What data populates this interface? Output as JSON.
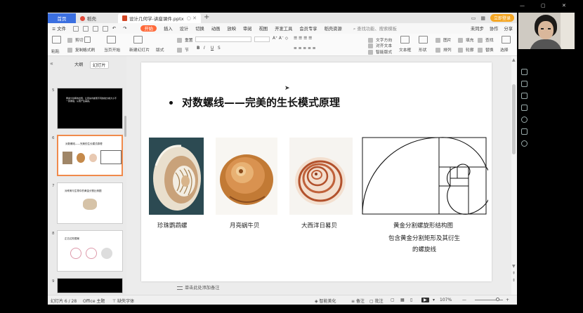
{
  "window_controls": [
    "—",
    "▢",
    "✕"
  ],
  "tabs": {
    "home": "首页",
    "draft": "稻壳",
    "file": "设计几何学-讲座课件.pptx"
  },
  "topbar_right": {
    "login": "立即登录"
  },
  "menu": {
    "file": "文件",
    "items": [
      "开始",
      "插入",
      "设计",
      "切换",
      "动画",
      "放映",
      "审阅",
      "视图",
      "开发工具",
      "会员专享",
      "稻壳资源"
    ],
    "active_index": 0,
    "search": "查找功能、搜索模板",
    "right": [
      "未同步",
      "协作",
      "分享"
    ]
  },
  "ribbon": {
    "paste": "粘贴",
    "cut": "剪切",
    "copy": "复制",
    "format_painter": "格式刷",
    "from_current": "当页开始",
    "new_slide": "新建幻灯片",
    "layout": "版式",
    "section": "节",
    "reset": "重置",
    "convert_smartart": "转换成图示",
    "text_box": "文本框",
    "shape": "形状",
    "picture": "图片",
    "arrange": "排列",
    "find": "查找",
    "replace": "替换",
    "select": "选择",
    "fill": "填充",
    "outline": "轮廓",
    "text_direction": "文字方向",
    "align_text": "对齐文本",
    "smart_layout": "智能版式"
  },
  "left_panel": {
    "tab_outline": "大纲",
    "tab_slides": "幻灯片",
    "slides": [
      {
        "num": "5",
        "text": "黄金分割率的出现，让原先均衡而不同的线分成大小不一的重组，从而产生美感。"
      },
      {
        "num": "6",
        "text": "对数螺线——完美的生长模式原理"
      },
      {
        "num": "7",
        "text": "对称美与生物中的黄金分割比例图"
      },
      {
        "num": "8",
        "text": "正五边形图案"
      },
      {
        "num": "9",
        "text": ""
      }
    ]
  },
  "slide": {
    "title": "对数螺线——完美的生长模式原理",
    "captions": {
      "nautilus": "珍珠鹦鹉螺",
      "moon_snail": "月亮蜗牛贝",
      "atlantic": "大西洋日晷贝",
      "golden_1": "黄金分割螺旋形结构图",
      "golden_2": "包含黄金分割矩形及其衍生",
      "golden_3": "的螺旋线"
    }
  },
  "notes_placeholder": "单击此处添加备注",
  "statusbar": {
    "slide_count": "幻灯片 6 / 28",
    "theme": "Office 主题",
    "missing_font": "缺失字体",
    "smart_beautify": "智能美化",
    "notes": "备注",
    "comments": "批注",
    "zoom": "107%"
  }
}
